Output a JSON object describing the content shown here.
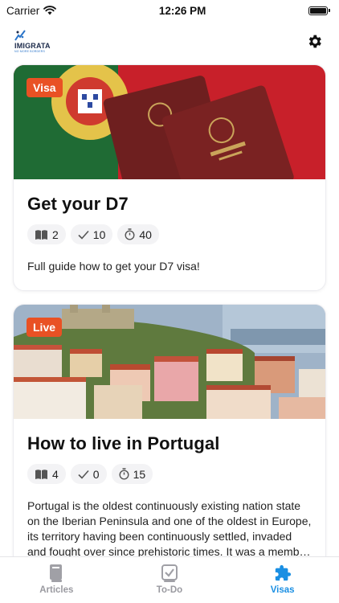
{
  "status_bar": {
    "carrier": "Carrier",
    "time": "12:26 PM"
  },
  "header": {
    "logo_name": "IMIGRATA",
    "logo_tagline": "NO MORE BORDERS",
    "settings_icon": "gear-icon"
  },
  "cards": [
    {
      "tag": "Visa",
      "title": "Get your D7",
      "stats": {
        "articles": "2",
        "todos": "10",
        "minutes": "40"
      },
      "description": "Full guide how to get your D7 visa!"
    },
    {
      "tag": "Live",
      "title": "How to live in Portugal",
      "stats": {
        "articles": "4",
        "todos": "0",
        "minutes": "15"
      },
      "description": "Portugal is the oldest continuously existing nation state on the Iberian Peninsula and one of the oldest in Europe, its territory having been continuously settled, invaded and fought over since prehistoric times. It was a member of the original founding states of NATO."
    }
  ],
  "tabs": [
    {
      "label": "Articles",
      "icon": "book-icon",
      "active": false
    },
    {
      "label": "To-Do",
      "icon": "checklist-icon",
      "active": false
    },
    {
      "label": "Visas",
      "icon": "puzzle-icon",
      "active": true
    }
  ],
  "colors": {
    "accent": "#1a8fe3",
    "tag": "#e95124",
    "inactive": "#9a9aa0"
  }
}
